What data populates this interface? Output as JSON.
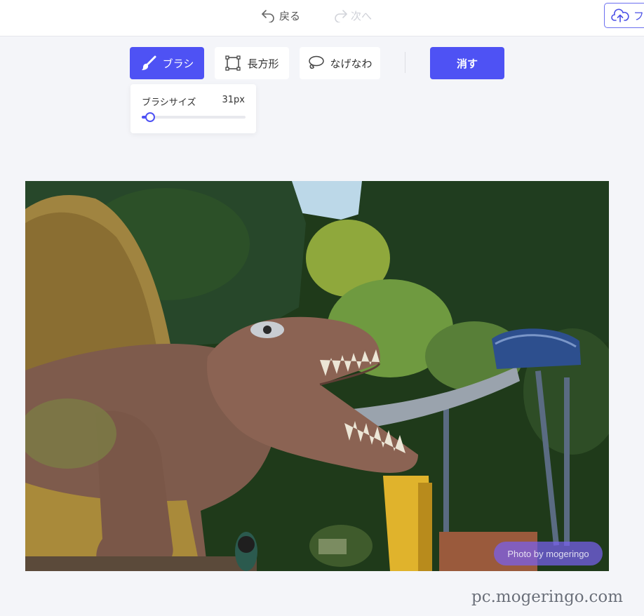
{
  "history": {
    "undo_label": "戻る",
    "redo_label": "次へ"
  },
  "upload": {
    "label": "フ"
  },
  "tools": [
    {
      "label": "ブラシ",
      "icon": "brush-icon",
      "active": true
    },
    {
      "label": "長方形",
      "icon": "rectangle-icon",
      "active": false
    },
    {
      "label": "なげなわ",
      "icon": "lasso-icon",
      "active": false
    }
  ],
  "erase_label": "消す",
  "brush_size": {
    "label": "ブラシサイズ",
    "value_text": "31px",
    "level_fraction": 0.04
  },
  "image": {
    "credit": "Photo by mogeringo"
  },
  "watermark": "pc.mogeringo.com",
  "colors": {
    "accent": "#4e52f4",
    "background": "#f4f5f9"
  }
}
